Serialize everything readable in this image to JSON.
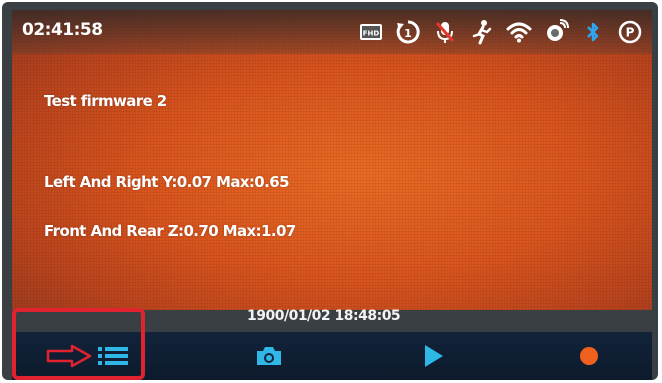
{
  "status_bar": {
    "clock": "02:41:58",
    "icons": [
      {
        "name": "fhd-resolution-icon",
        "label": "FHD"
      },
      {
        "name": "loop-recording-1-icon",
        "label": "1"
      },
      {
        "name": "mic-muted-icon"
      },
      {
        "name": "motion-detection-icon"
      },
      {
        "name": "wifi-icon"
      },
      {
        "name": "gps-satellite-icon"
      },
      {
        "name": "bluetooth-icon"
      },
      {
        "name": "parking-mode-icon",
        "label": "P"
      }
    ]
  },
  "main": {
    "firmware_label": "Test firmware 2",
    "left_right_line": "Left And Right  Y:0.07 Max:0.65",
    "front_rear_line": "Front And Rear  Z:0.70 Max:1.07",
    "datetime": "1900/01/02  18:48:05"
  },
  "bottom_bar": {
    "buttons": [
      {
        "name": "menu-button",
        "icon": "menu-icon"
      },
      {
        "name": "photo-button",
        "icon": "camera-icon"
      },
      {
        "name": "playback-button",
        "icon": "play-icon"
      },
      {
        "name": "record-button",
        "icon": "record-dot-icon"
      }
    ]
  },
  "annotation": {
    "color": "#e0232f",
    "target": "menu-button",
    "arrow_icon": "arrow-right-icon"
  },
  "colors": {
    "screen_orange": "#d9541d",
    "icon_cyan": "#2fb7e8",
    "record_orange": "#f0601e",
    "bottom_bar": "#12233a"
  }
}
